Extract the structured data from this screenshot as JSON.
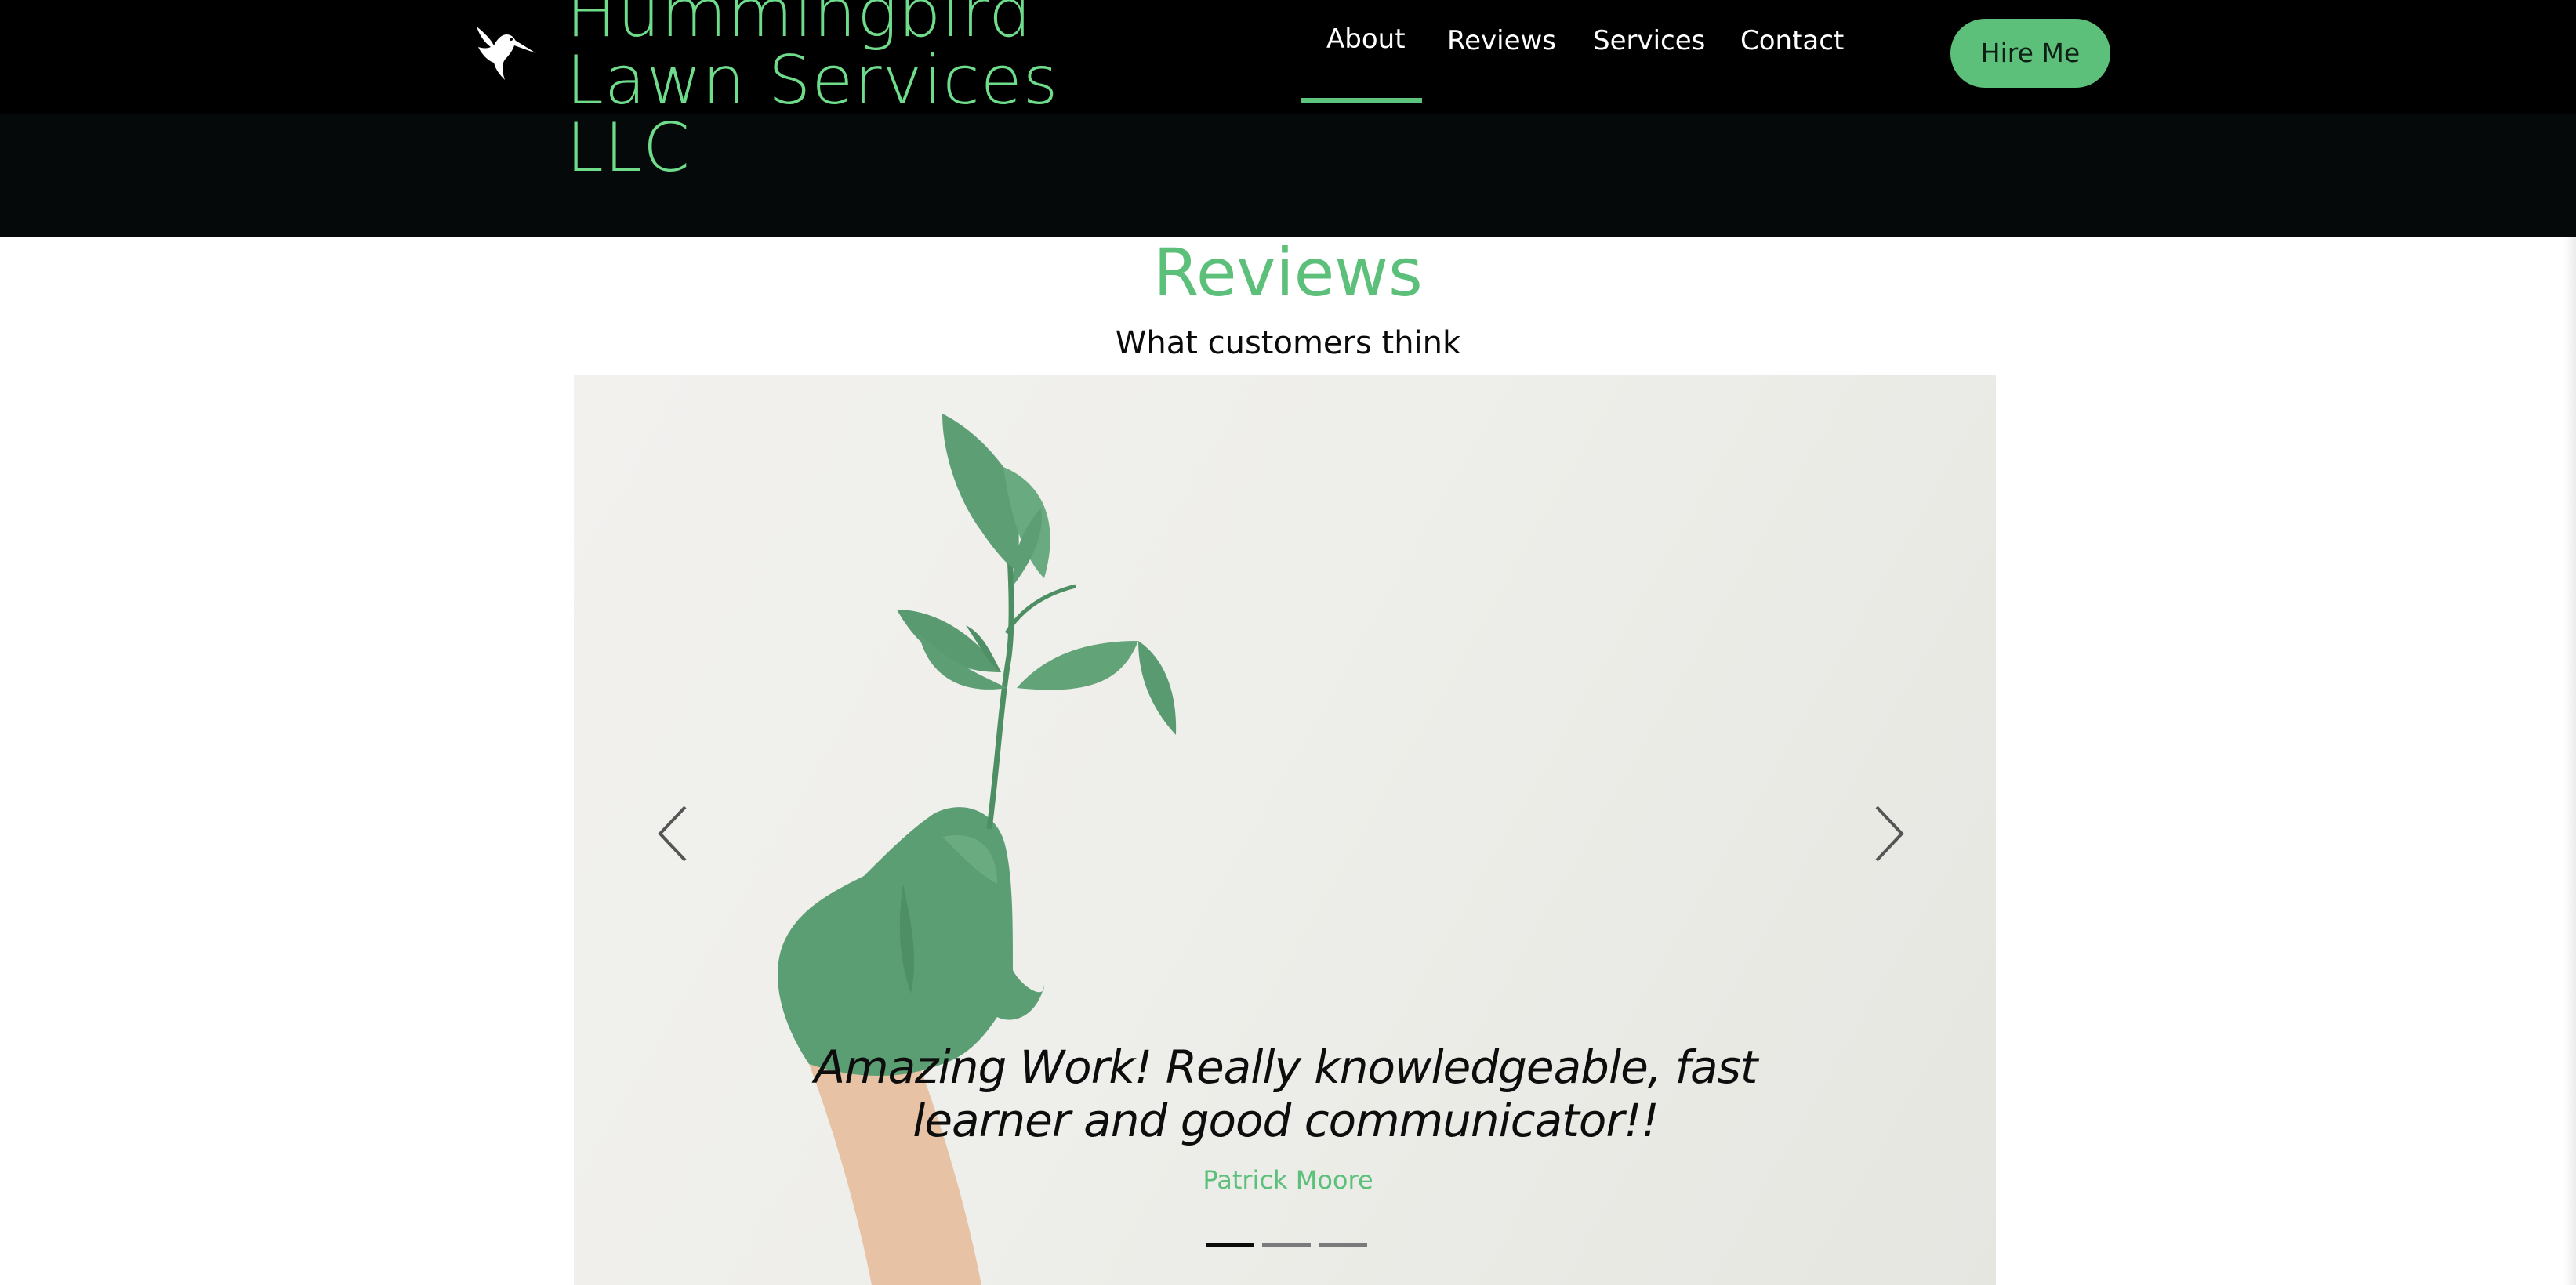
{
  "brand": {
    "line1": "Hummingbird",
    "line2": "Lawn Services LLC",
    "logo_icon": "hummingbird-icon"
  },
  "nav": {
    "items": [
      {
        "label": "About",
        "active": true
      },
      {
        "label": "Reviews",
        "active": false
      },
      {
        "label": "Services",
        "active": false
      },
      {
        "label": "Contact",
        "active": false
      }
    ],
    "cta": "Hire Me"
  },
  "reviews": {
    "title": "Reviews",
    "subtitle": "What customers think",
    "quote_line1": "Amazing Work! Really knowledgeable, fast",
    "quote_line2": "learner and good communicator!!",
    "author": "Patrick Moore",
    "slides": {
      "count": 3,
      "active_index": 0
    },
    "prev_icon": "chevron-left-icon",
    "next_icon": "chevron-right-icon"
  },
  "colors": {
    "accent": "#5cbf7a",
    "brand_text": "#6fdc8c",
    "header_bg": "#000000",
    "leaf": "#5a9e72"
  }
}
